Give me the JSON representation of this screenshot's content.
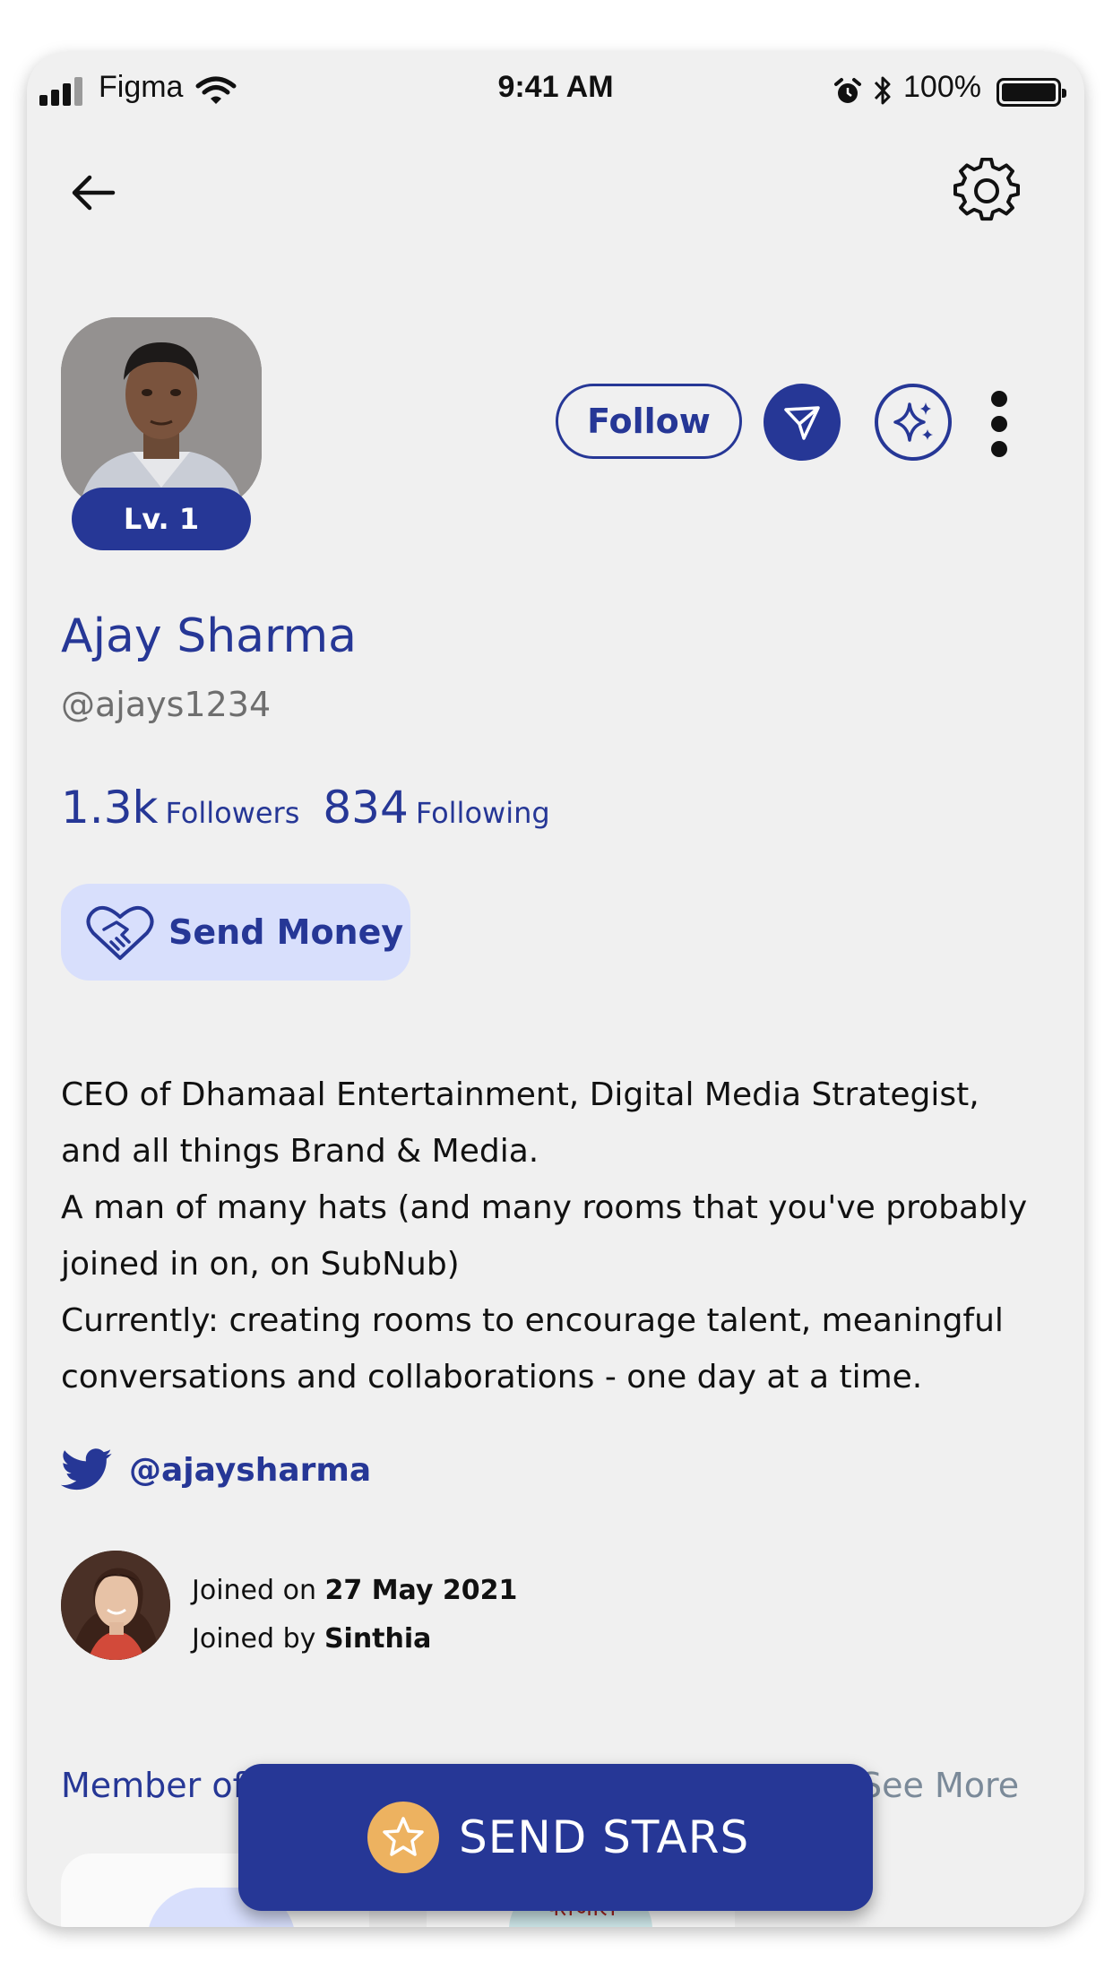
{
  "status_bar": {
    "carrier": "Figma",
    "time": "9:41 AM",
    "battery": "100%"
  },
  "profile": {
    "level": "Lv. 1",
    "name": "Ajay Sharma",
    "handle": "@ajays1234",
    "followers_count": "1.3k",
    "followers_label": "Followers",
    "following_count": "834",
    "following_label": "Following"
  },
  "actions": {
    "follow_label": "Follow",
    "send_money_label": "Send Money"
  },
  "bio": {
    "lines": [
      "CEO of Dhamaal Entertainment, Digital Media Strategist,",
      "and all things Brand & Media.",
      "A man of many hats (and many rooms that you've probably",
      "joined in on, on SubNub)",
      "Currently: creating rooms to encourage talent, meaningful",
      "conversations and collaborations - one day at a time."
    ]
  },
  "twitter": {
    "handle": "@ajaysharma"
  },
  "joined": {
    "joined_on_label": "Joined on",
    "joined_on_date": "27 May 2021",
    "joined_by_label": "Joined by",
    "joined_by_name": "Sinthia"
  },
  "membership": {
    "label": "Member of",
    "see_more": "See More",
    "card2_logo_text": "पतंजलि"
  },
  "cta": {
    "send_stars_label": "SEND STARS"
  },
  "colors": {
    "primary": "#263796",
    "light_accent": "#d8dffc",
    "coin": "#edb260",
    "background": "#f0f0f0"
  },
  "icons": [
    "back-arrow-icon",
    "gear-icon",
    "send-icon",
    "sparkles-icon",
    "more-vertical-icon",
    "heart-handshake-icon",
    "twitter-icon",
    "star-icon"
  ]
}
